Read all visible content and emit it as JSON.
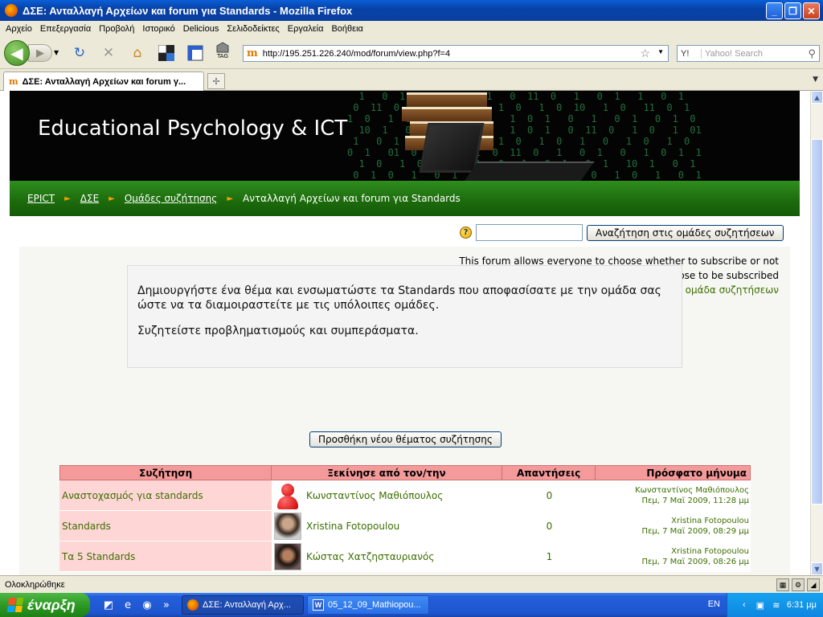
{
  "window": {
    "title": "ΔΣΕ: Ανταλλαγή Αρχείων και forum για Standards - Mozilla Firefox",
    "controls": [
      "_",
      "❐",
      "✕"
    ]
  },
  "menubar": {
    "items": [
      "Αρχείο",
      "Επεξεργασία",
      "Προβολή",
      "Ιστορικό",
      "Delicious",
      "Σελιδοδείκτες",
      "Εργαλεία",
      "Βοήθεια"
    ]
  },
  "navbar": {
    "url": "http://195.251.226.240/mod/forum/view.php?f=4",
    "url_favicon": "m",
    "search_engine": "Y!",
    "search_placeholder": "Yahoo! Search",
    "tag_label": "TAG"
  },
  "tabs": [
    {
      "label": "ΔΣΕ: Ανταλλαγή Αρχείων και forum γ...",
      "favicon": "m"
    }
  ],
  "site": {
    "title": "Educational Psychology & ICT"
  },
  "breadcrumb": {
    "items": [
      "EPICT",
      "ΔΣΕ",
      "Ομάδες συζήτησης"
    ],
    "current": "Ανταλλαγή Αρχείων και forum για Standards",
    "separator": "►"
  },
  "forum": {
    "search_button": "Αναζήτηση στις ομάδες συζητήσεων",
    "search_value": "",
    "subscribe_info": "This forum allows everyone to choose whether to subscribe or not",
    "subscribe_status": "Everyone can now choose to be subscribed",
    "unsubscribe_link": "Διαγραφείτε από αυτή την ομάδα συζητήσεων",
    "intro_p1": "Δημιουργήστε ένα θέμα και ενσωματώστε τα Standards που αποφασίσατε με την ομάδα σας ώστε να τα διαμοιραστείτε με τις υπόλοιπες ομάδες.",
    "intro_p2": "Συζητείστε προβληματισμούς και συμπεράσματα.",
    "add_button": "Προσθήκη νέου θέματος συζήτησης",
    "help_glyph": "?"
  },
  "table": {
    "headers": [
      "Συζήτηση",
      "Ξεκίνησε από τον/την",
      "Απαντήσεις",
      "Πρόσφατο μήνυμα"
    ],
    "rows": [
      {
        "discussion": "Αναστοχασμός για standards",
        "started_by": "Κωνσταντίνος Μαθιόπουλος",
        "avatar": "default-user-icon",
        "replies": "0",
        "last_author": "Κωνσταντίνος Μαθιόπουλος",
        "last_date": "Πεμ, 7 Μαϊ 2009, 11:28 μμ"
      },
      {
        "discussion": "Standards",
        "started_by": "Xristina Fotopoulou",
        "avatar": "user-photo",
        "replies": "0",
        "last_author": "Xristina Fotopoulou",
        "last_date": "Πεμ, 7 Μαϊ 2009, 08:29 μμ"
      },
      {
        "discussion": "Τα 5 Standards",
        "started_by": "Κώστας Χατζησταυριανός",
        "avatar": "user-photo",
        "replies": "1",
        "last_author": "Xristina Fotopoulou",
        "last_date": "Πεμ, 7 Μαϊ 2009, 08:26 μμ"
      }
    ]
  },
  "statusbar": {
    "text": "Ολοκληρώθηκε"
  },
  "taskbar": {
    "start": "έναρξη",
    "items": [
      {
        "label": "ΔΣΕ: Ανταλλαγή Αρχ...",
        "active": true
      },
      {
        "label": "05_12_09_Mathiopou...",
        "active": false
      }
    ],
    "lang": "EN",
    "clock": "6:31 μμ"
  },
  "colors": {
    "link_green": "#3c6e00",
    "table_header": "#f59a9a",
    "table_discussion_bg": "#ffd6d6",
    "breadcrumb_bar": "#1c6a0c",
    "breadcrumb_separator": "#f4a000"
  }
}
